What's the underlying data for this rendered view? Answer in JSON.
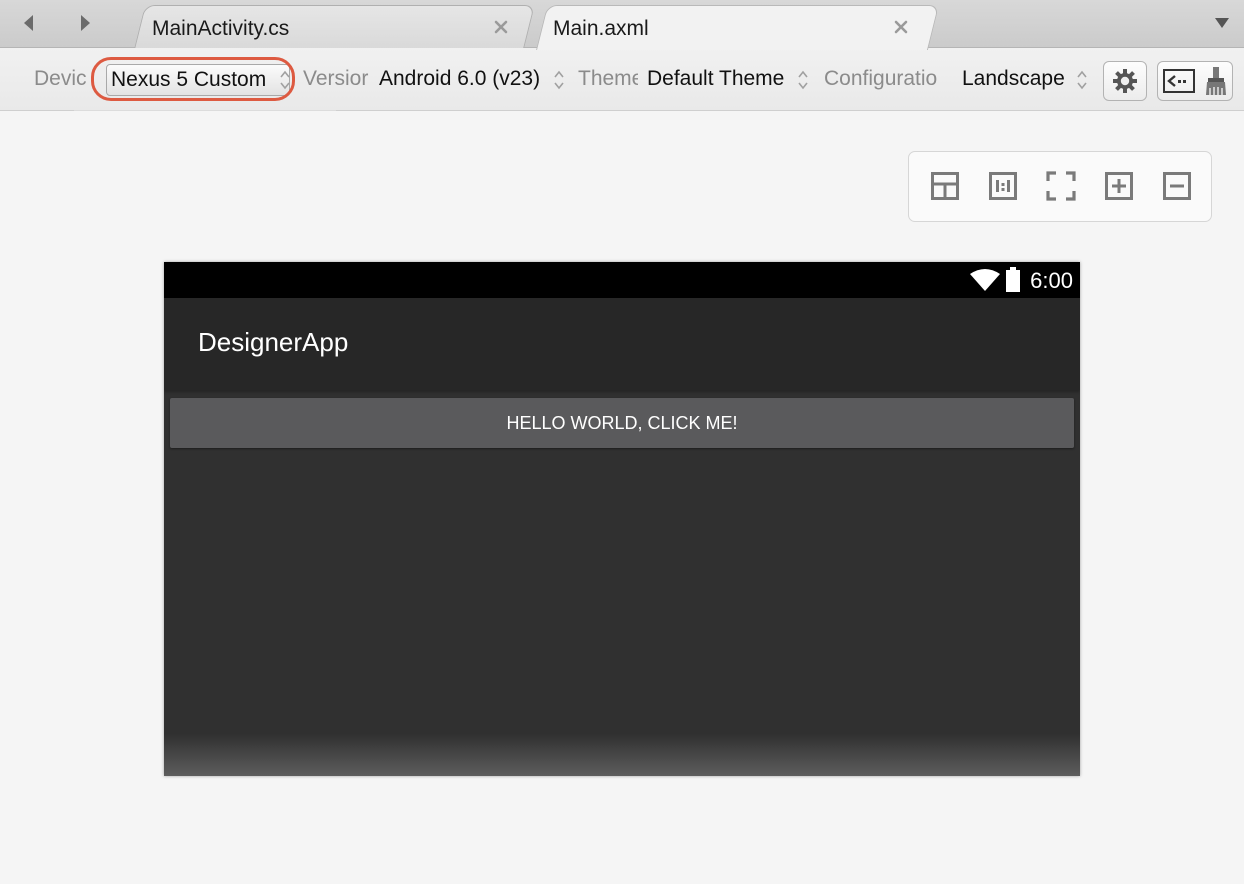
{
  "tabs": [
    {
      "label": "MainActivity.cs",
      "active": false
    },
    {
      "label": "Main.axml",
      "active": true
    }
  ],
  "toolbar": {
    "device_label": "Devic",
    "device_value": "Nexus 5 Custom",
    "version_label": "Versior",
    "version_value": "Android 6.0 (v23)",
    "theme_label": "Theme",
    "theme_value": "Default Theme",
    "configuration_label": "Configuratio",
    "configuration_value": "Landscape"
  },
  "phone": {
    "status_time": "6:00",
    "app_title": "DesignerApp",
    "button_label": "HELLO WORLD, CLICK ME!"
  },
  "colors": {
    "highlight": "#dd5a41",
    "phone_background": "#303030",
    "actionbar": "#272727",
    "button": "#5a5a5c"
  },
  "icons": [
    "back-arrow-icon",
    "forward-arrow-icon",
    "close-icon",
    "overflow-chevron-icon",
    "gear-icon",
    "source-view-icon",
    "brush-icon",
    "layout-icon",
    "actual-size-icon",
    "fit-screen-icon",
    "zoom-in-icon",
    "zoom-out-icon",
    "wifi-icon",
    "battery-icon"
  ]
}
